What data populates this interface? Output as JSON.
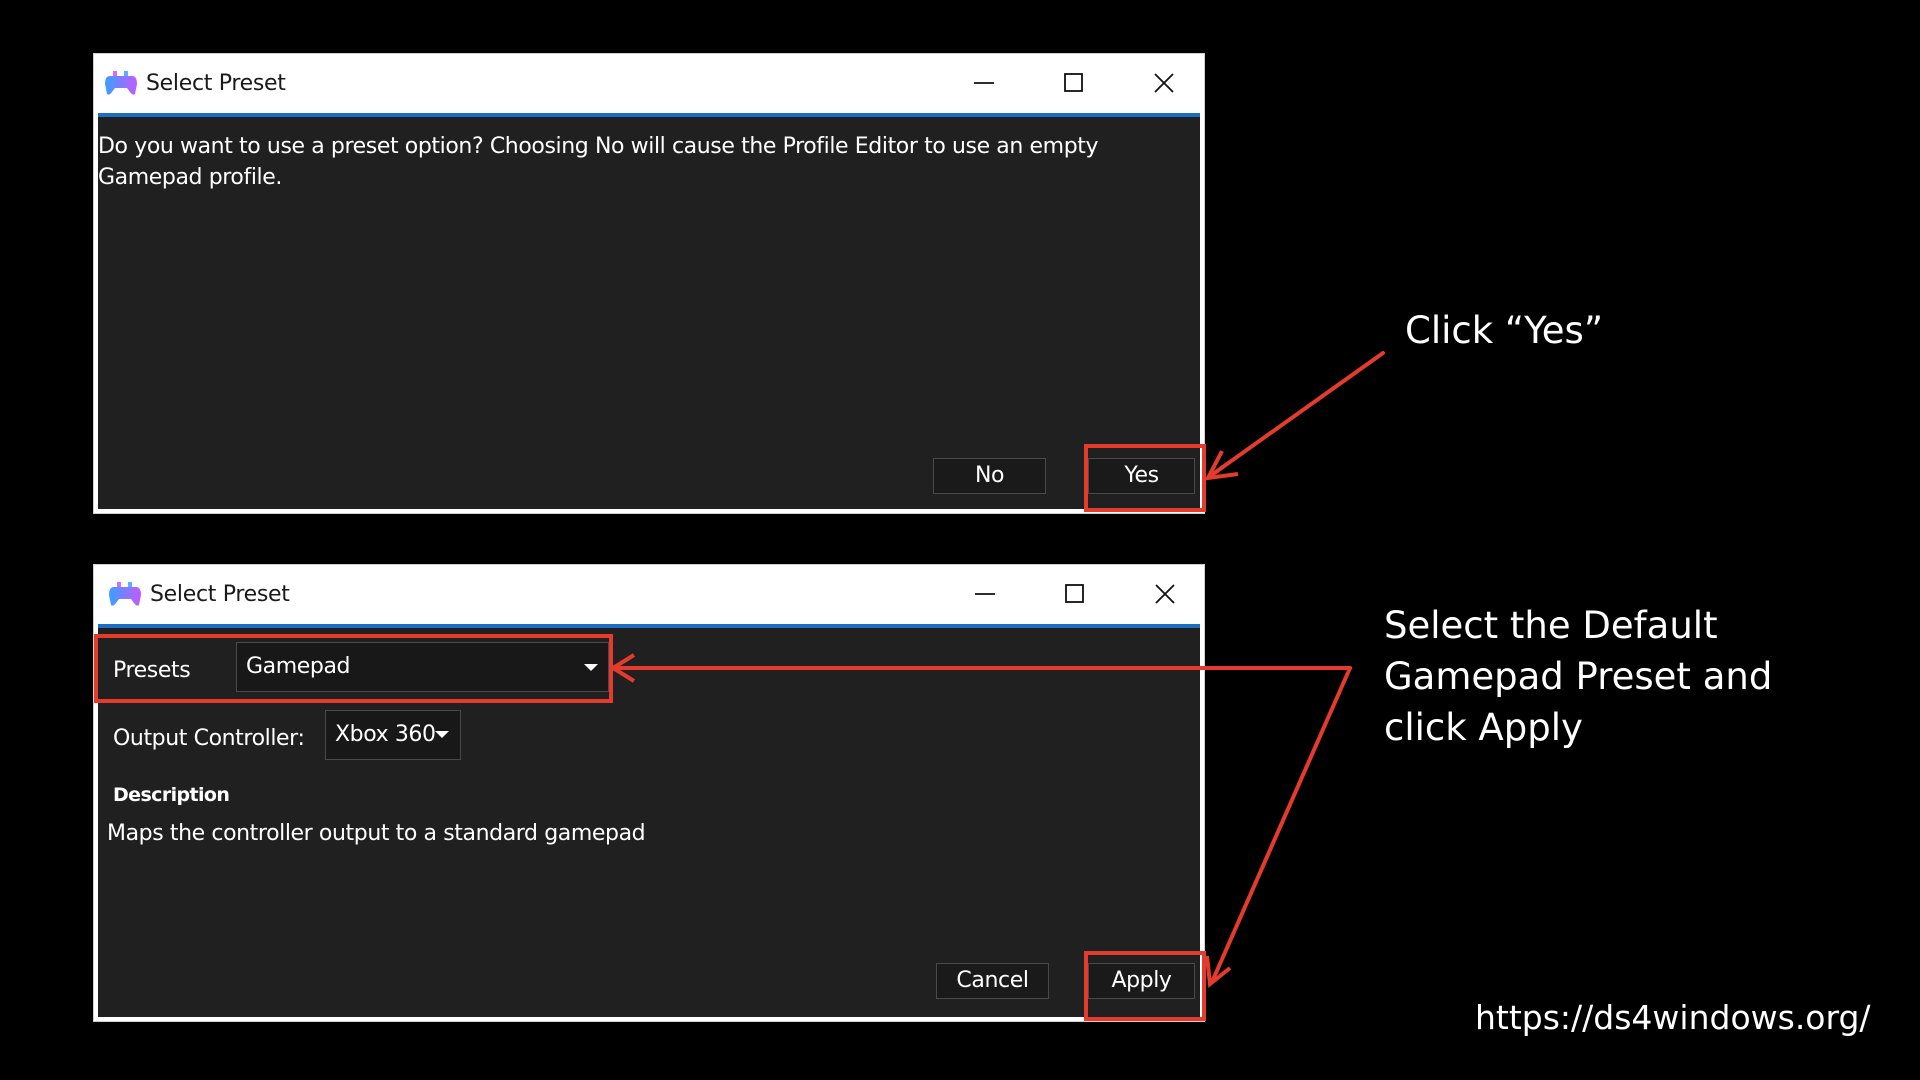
{
  "dialogs": [
    {
      "title": "Select Preset",
      "message": "Do you want to use a preset option? Choosing No will cause the Profile Editor to use an empty Gamepad profile.",
      "buttons": {
        "no": "No",
        "yes": "Yes"
      }
    },
    {
      "title": "Select Preset",
      "presets_label": "Presets",
      "presets_value": "Gamepad",
      "output_label": "Output Controller:",
      "output_value": "Xbox 360",
      "description_heading": "Description",
      "description_text": "Maps the controller output to a standard gamepad",
      "buttons": {
        "cancel": "Cancel",
        "apply": "Apply"
      }
    }
  ],
  "annotations": {
    "step1": "Click “Yes”",
    "step2": "Select the Default Gamepad Preset and click Apply",
    "url": "https://ds4windows.org/"
  },
  "colors": {
    "highlight": "#e53b2d",
    "accent": "#1b6ec2",
    "client_bg": "#202020"
  },
  "icons": [
    "gamepad-icon",
    "minimize-icon",
    "maximize-icon",
    "close-icon",
    "chevron-down-icon"
  ]
}
